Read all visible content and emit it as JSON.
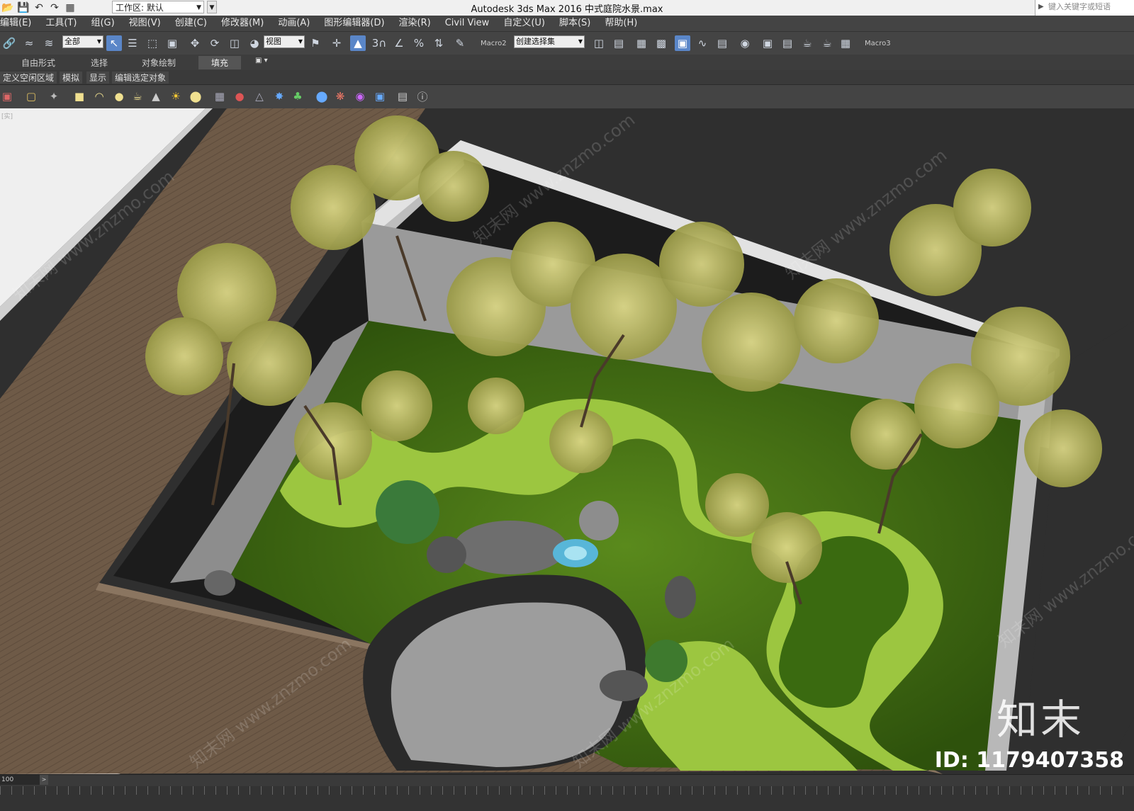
{
  "titlebar": {
    "workspace_label": "工作区: 默认",
    "app_title": "Autodesk 3ds Max 2016     中式庭院水景.max",
    "search_placeholder": "键入关键字或短语"
  },
  "menu": [
    "编辑(E)",
    "工具(T)",
    "组(G)",
    "视图(V)",
    "创建(C)",
    "修改器(M)",
    "动画(A)",
    "图形编辑器(D)",
    "渲染(R)",
    "Civil View",
    "自定义(U)",
    "脚本(S)",
    "帮助(H)"
  ],
  "toolbar": {
    "selection_filter": "全部",
    "coord_system": "视图",
    "named_selection": "创建选择集",
    "macro2": "Macro2",
    "macro3": "Macro3"
  },
  "ribbon": {
    "tabs": [
      "自由形式",
      "选择",
      "对象绘制",
      "填充"
    ],
    "active_tab": "填充"
  },
  "subtabs": [
    "定义空闲区域",
    "模拟",
    "显示",
    "编辑选定对象"
  ],
  "viewport": {
    "label": "[实]",
    "watermark": "知末网 www.znzmo.com",
    "logo": "知末",
    "id_text": "ID: 1179407358"
  },
  "timeline": {
    "frame": "100",
    "next": ">"
  },
  "colors": {
    "lawn": "#9cc640",
    "moss": "#3f6a14",
    "deck": "#6e5a47",
    "wall": "#9a9a9a",
    "accent": "#5a86c8"
  }
}
